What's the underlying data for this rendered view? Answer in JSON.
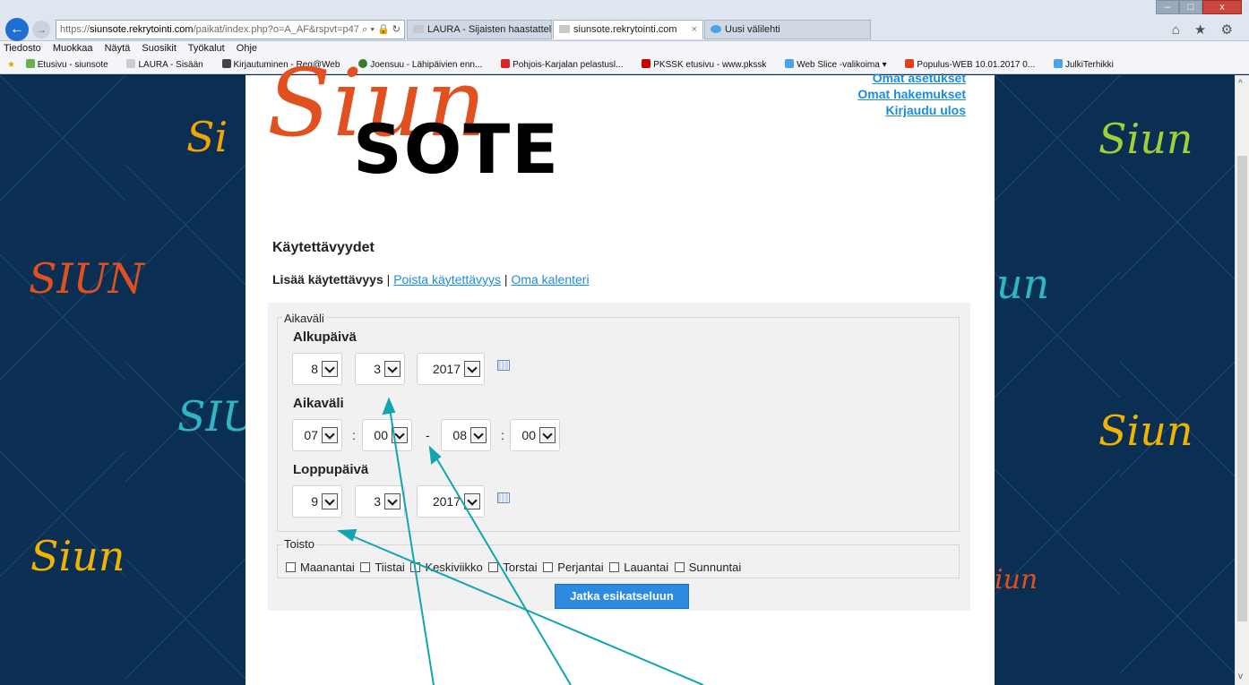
{
  "browser": {
    "address": {
      "scheme": "https://",
      "host": "siunsote.rekrytointi.com",
      "path": "/paikat/index.php?o=A_AF&rspvt=p47"
    },
    "address_tools": "⌕ ▾ 🔒 ↻",
    "tabs": [
      {
        "label": "LAURA - Sijaisten haastattelulo...",
        "active": false
      },
      {
        "label": "siunsote.rekrytointi.com",
        "active": true
      },
      {
        "label": "Uusi välilehti",
        "active": false
      }
    ],
    "tab_close": "×",
    "menu": [
      "Tiedosto",
      "Muokkaa",
      "Näytä",
      "Suosikit",
      "Työkalut",
      "Ohje"
    ],
    "favorites": [
      "Etusivu - siunsote",
      "LAURA - Sisään",
      "Kirjautuminen - Reg@Web",
      "Joensuu - Lähipäivien enn...",
      "Pohjois-Karjalan pelastusl...",
      "PKSSK etusivu - www.pkssk",
      "Web Slice -valikoima ▾",
      "Populus-WEB 10.01.2017 0...",
      "JulkiTerhikki"
    ],
    "window_buttons": [
      "–",
      "□",
      "x"
    ],
    "right_icons": "⌂ ★ ⚙"
  },
  "background_words": [
    "Siun",
    "SIUN",
    "SIU",
    "Siun",
    "Siun",
    "Siun",
    "Siun",
    "un",
    "iun",
    "Si"
  ],
  "logo": {
    "script": "Siun",
    "word": "SOTE"
  },
  "user_links": [
    "Omat asetukset",
    "Omat hakemukset",
    "Kirjaudu ulos"
  ],
  "page": {
    "title": "Käytettävyydet",
    "subnav": {
      "current": "Lisää käytettävyys",
      "sep": "|",
      "link1": "Poista käytettävyys",
      "link2": "Oma kalenteri"
    }
  },
  "form": {
    "range_legend": "Aikaväli",
    "start_label": "Alkupäivä",
    "start": {
      "day": "8",
      "month": "3",
      "year": "2017"
    },
    "time_label": "Aikaväli",
    "time": {
      "from_h": "07",
      "from_m": "00",
      "to_h": "08",
      "to_m": "00",
      "colon": ":",
      "dash": "-"
    },
    "end_label": "Loppupäivä",
    "end": {
      "day": "9",
      "month": "3",
      "year": "2017"
    },
    "repeat_legend": "Toisto",
    "days": [
      "Maanantai",
      "Tiistai",
      "Keskiviikko",
      "Torstai",
      "Perjantai",
      "Lauantai",
      "Sunnuntai"
    ],
    "submit": "Jatka esikatseluun"
  },
  "colors": {
    "accent": "#2d8ae0",
    "link": "#1a8de0",
    "logo": "#e2501f",
    "background": "#0b2f52",
    "annotation": "#10a5b0"
  }
}
